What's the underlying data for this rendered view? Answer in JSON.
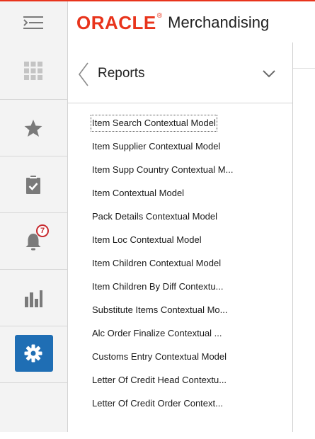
{
  "header": {
    "brand": "ORACLE",
    "brand_mark": "®",
    "product": "Merchandising"
  },
  "rail": {
    "items": [
      {
        "icon": "grid-icon",
        "label": "Tasks"
      },
      {
        "icon": "star-icon",
        "label": "Favorites"
      },
      {
        "icon": "clipboard-check-icon",
        "label": "Reports"
      },
      {
        "icon": "bell-icon",
        "label": "Notifications",
        "badge": "7"
      },
      {
        "icon": "bar-chart-icon",
        "label": "Dashboards"
      },
      {
        "icon": "gear-icon",
        "label": "Settings",
        "active": true
      }
    ],
    "notification_count": "7"
  },
  "panel": {
    "title": "Reports",
    "items": [
      "Item Search Contextual Model",
      "Item Supplier Contextual Model",
      "Item Supp Country Contextual M...",
      "Item Contextual Model",
      "Pack Details Contextual Model",
      "Item Loc Contextual Model",
      "Item Children Contextual Model",
      "Item Children By Diff Contextu...",
      "Substitute Items Contextual Mo...",
      "Alc Order Finalize Contextual ...",
      "Customs Entry Contextual Model",
      "Letter Of Credit Head Contextu...",
      "Letter Of Credit Order Context..."
    ]
  },
  "colors": {
    "brand_red": "#e8341c",
    "active_blue": "#1f6eb4",
    "badge_red": "#c7292e"
  }
}
